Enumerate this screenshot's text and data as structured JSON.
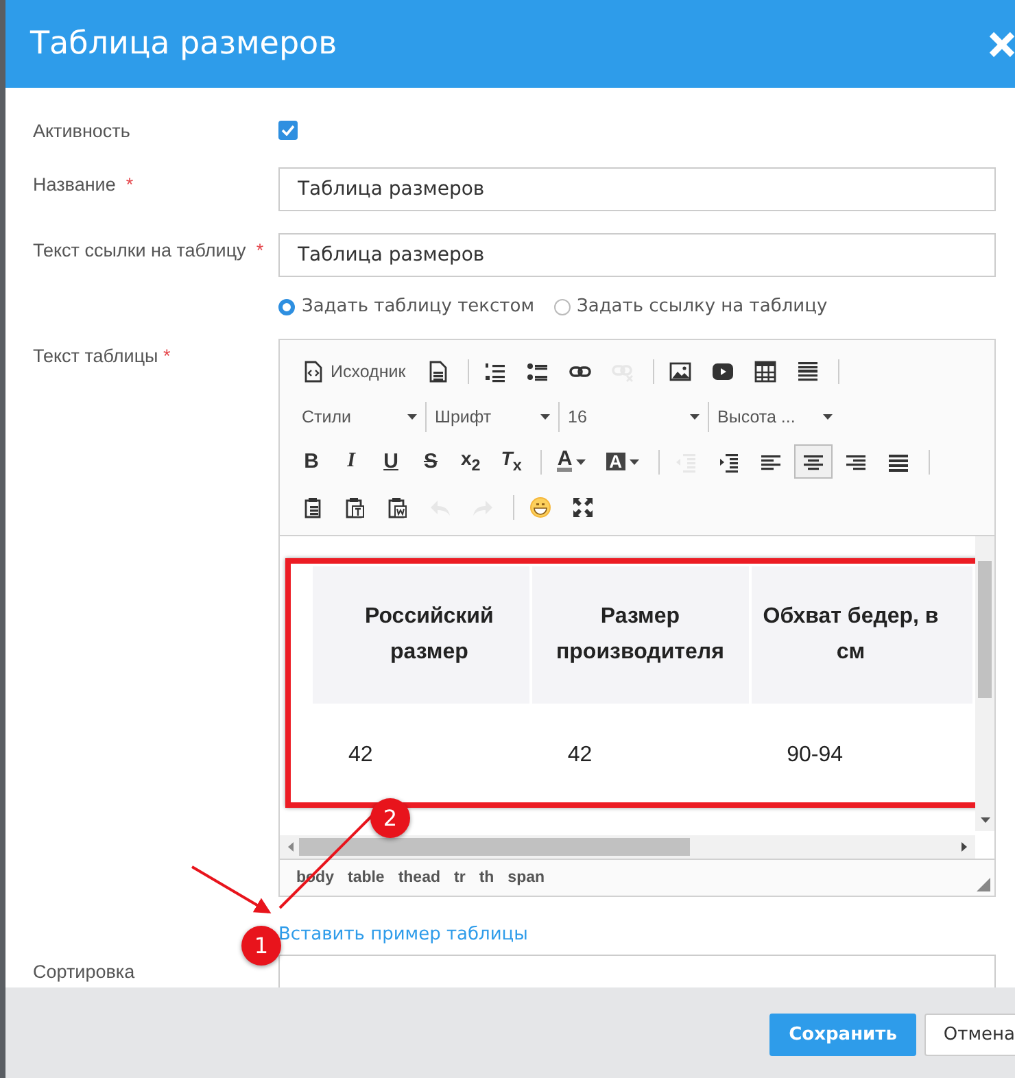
{
  "dialog": {
    "title": "Таблица размеров"
  },
  "fields": [
    {
      "kind": "checkbox",
      "label": "Активность",
      "checked": true
    },
    {
      "kind": "text",
      "label": "Название",
      "required_mark": "*",
      "value": "Таблица размеров"
    },
    {
      "kind": "text",
      "label": "Текст ссылки на таблицу",
      "required_mark": "*",
      "value": "Таблица размеров"
    }
  ],
  "radios": [
    {
      "label": "Задать таблицу текстом",
      "selected": true
    },
    {
      "label": "Задать ссылку на таблицу",
      "selected": false
    }
  ],
  "editor": {
    "label": "Текст таблицы",
    "required_mark": "*",
    "toolbar_rows": [
      [
        {
          "kind": "source",
          "label": "Исходник",
          "disabled": false,
          "pressed": false
        },
        {
          "kind": "doc",
          "disabled": false,
          "pressed": false
        },
        {
          "kind": "sep"
        },
        {
          "kind": "ol",
          "disabled": false,
          "pressed": false
        },
        {
          "kind": "ul",
          "disabled": false,
          "pressed": false
        },
        {
          "kind": "link",
          "disabled": false,
          "pressed": false
        },
        {
          "kind": "unlink",
          "disabled": true,
          "pressed": false
        },
        {
          "kind": "sep"
        },
        {
          "kind": "image",
          "disabled": false,
          "pressed": false
        },
        {
          "kind": "video",
          "disabled": false,
          "pressed": false
        },
        {
          "kind": "table",
          "disabled": false,
          "pressed": false
        },
        {
          "kind": "hr",
          "disabled": false,
          "pressed": false
        },
        {
          "kind": "sep"
        }
      ],
      [
        {
          "kind": "dropdown",
          "label": "Стили"
        },
        {
          "kind": "dropdown",
          "label": "Шрифт"
        },
        {
          "kind": "dropdown",
          "label": "16"
        },
        {
          "kind": "dropdown",
          "label": "Высота ..."
        }
      ],
      [
        {
          "kind": "bold",
          "label": "B",
          "disabled": false,
          "pressed": false
        },
        {
          "kind": "italic",
          "label": "I",
          "disabled": false,
          "pressed": false
        },
        {
          "kind": "underline",
          "label": "U",
          "disabled": false,
          "pressed": false
        },
        {
          "kind": "strike",
          "label": "S",
          "disabled": false,
          "pressed": false
        },
        {
          "kind": "script",
          "label": "x$_{2}$",
          "disabled": false,
          "pressed": false
        },
        {
          "kind": "script",
          "label": "*T*$_{x}$",
          "disabled": false,
          "pressed": false
        },
        {
          "kind": "sep"
        },
        {
          "kind": "textcolor",
          "label": "A",
          "disabled": false,
          "pressed": false
        },
        {
          "kind": "bgcolor",
          "label": "A",
          "disabled": false,
          "pressed": false
        },
        {
          "kind": "sep"
        },
        {
          "kind": "outdent",
          "disabled": true,
          "pressed": false
        },
        {
          "kind": "indent",
          "disabled": false,
          "pressed": false
        },
        {
          "kind": "left",
          "disabled": false,
          "pressed": false
        },
        {
          "kind": "center",
          "disabled": false,
          "pressed": true
        },
        {
          "kind": "right",
          "disabled": false,
          "pressed": false
        },
        {
          "kind": "justify",
          "disabled": false,
          "pressed": false
        },
        {
          "kind": "sep"
        }
      ],
      [
        {
          "kind": "paste",
          "disabled": false,
          "pressed": false
        },
        {
          "kind": "pastetext",
          "disabled": false,
          "pressed": false
        },
        {
          "kind": "pasteword",
          "disabled": false,
          "pressed": false
        },
        {
          "kind": "undo",
          "disabled": true,
          "pressed": false
        },
        {
          "kind": "redo",
          "disabled": true,
          "pressed": false
        },
        {
          "kind": "sep"
        },
        {
          "kind": "emoji",
          "disabled": false,
          "pressed": false
        },
        {
          "kind": "maximize",
          "disabled": false,
          "pressed": false
        }
      ]
    ],
    "table": {
      "header": [
        "Российский размер",
        "Размер производителя",
        "Обхват бедер, в см"
      ],
      "rows": [
        [
          "42",
          "42",
          "90-94"
        ]
      ]
    },
    "path": [
      "body",
      "table",
      "thead",
      "tr",
      "th",
      "span"
    ]
  },
  "insert_link": "Вставить пример таблицы",
  "sort_label": "Сортировка",
  "annotations": [
    {
      "label": "1"
    },
    {
      "label": "2"
    }
  ],
  "buttons": [
    {
      "label": "Сохранить",
      "kind": "primary"
    },
    {
      "label": "Отмена",
      "kind": "secondary"
    }
  ]
}
